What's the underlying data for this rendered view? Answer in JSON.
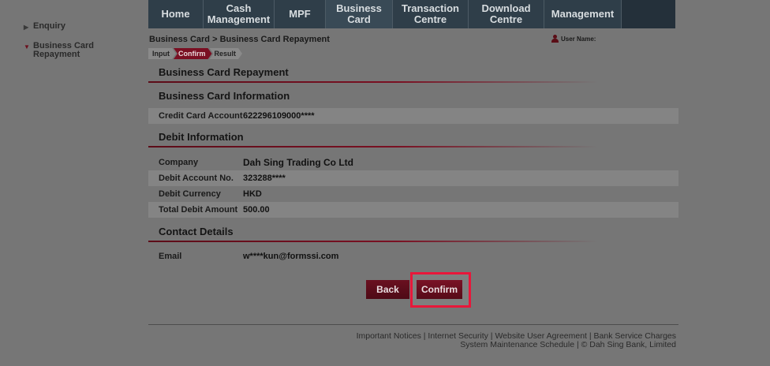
{
  "sidebar": {
    "items": [
      {
        "label": "Enquiry",
        "arrow": "▶",
        "expanded": false
      },
      {
        "label": "Business Card Repayment",
        "arrow": "▼",
        "expanded": true
      }
    ]
  },
  "nav": {
    "tabs": [
      {
        "label": "Home"
      },
      {
        "label": "Cash\nManagement"
      },
      {
        "label": "MPF"
      },
      {
        "label": "Business\nCard"
      },
      {
        "label": "Transaction\nCentre"
      },
      {
        "label": "Download\nCentre"
      },
      {
        "label": "Management"
      }
    ]
  },
  "breadcrumb": "Business Card > Business Card Repayment",
  "user": {
    "label": "User Name:"
  },
  "steps": [
    "Input",
    "Confirm",
    "Result"
  ],
  "sections": {
    "repayment": "Business Card Repayment",
    "card_info": "Business Card Information",
    "debit_info": "Debit Information",
    "contact": "Contact Details"
  },
  "card_info": {
    "account_label": "Credit Card Account",
    "account_value": "622296109000****"
  },
  "debit_info": {
    "rows": [
      {
        "label": "Company",
        "value": "Dah Sing Trading Co Ltd"
      },
      {
        "label": "Debit Account No.",
        "value": "323288****"
      },
      {
        "label": "Debit Currency",
        "value": "HKD"
      },
      {
        "label": "Total Debit Amount",
        "value": "500.00"
      }
    ]
  },
  "contact": {
    "email_label": "Email",
    "email_value": "w****kun@formssi.com"
  },
  "buttons": {
    "back": "Back",
    "confirm": "Confirm"
  },
  "footer": {
    "line1": "Important Notices | Internet Security | Website User Agreement | Bank Service Charges",
    "line2": "System Maintenance Schedule | © Dah Sing Bank, Limited"
  },
  "colors": {
    "accent": "#7a0f22",
    "highlight": "#e8173a",
    "nav": "#2f3e49"
  }
}
